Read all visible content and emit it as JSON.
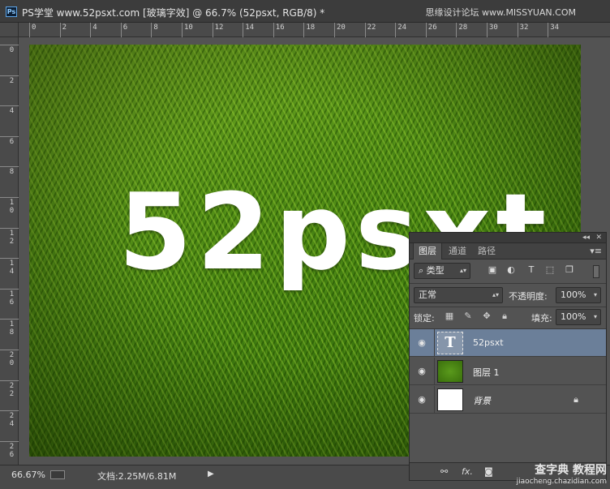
{
  "titlebar": {
    "app_badge": "Ps",
    "document_title": "PS学堂 www.52psxt.com [玻璃字效] @ 66.7% (52psxt, RGB/8) *",
    "watermark": "思缘设计论坛 www.MISSYUAN.COM"
  },
  "rulers": {
    "top": [
      "0",
      "2",
      "4",
      "6",
      "8",
      "10",
      "12",
      "14",
      "16",
      "18",
      "20",
      "22",
      "24",
      "26",
      "28",
      "30",
      "32",
      "34"
    ],
    "left": [
      "0",
      "2",
      "4",
      "6",
      "8",
      "10",
      "12",
      "14",
      "16",
      "18",
      "20",
      "22",
      "24",
      "26"
    ]
  },
  "canvas": {
    "text": "52psxt"
  },
  "statusbar": {
    "zoom": "66.67%",
    "doc_info": "文档:2.25M/6.81M",
    "menu_arrow": "▶"
  },
  "layers_panel": {
    "collapse": "◂◂",
    "close": "✕",
    "tabs": [
      {
        "label": "图层",
        "active": true
      },
      {
        "label": "通道",
        "active": false
      },
      {
        "label": "路径",
        "active": false
      }
    ],
    "menu": "▾≡",
    "filter_kind": "类型",
    "blend_mode": "正常",
    "opacity_label": "不透明度:",
    "opacity_value": "100%",
    "lock_label": "锁定:",
    "fill_label": "填充:",
    "fill_value": "100%",
    "layers": [
      {
        "name": "52psxt",
        "type": "text",
        "selected": true,
        "thumb_glyph": "T"
      },
      {
        "name": "图层 1",
        "type": "image",
        "selected": false
      },
      {
        "name": "背景",
        "type": "background",
        "selected": false,
        "locked": true
      }
    ],
    "bottom_icons": [
      "link-icon",
      "fx-icon",
      "mask-icon"
    ],
    "bottom_fx": "fx."
  },
  "watermark_bottom": {
    "line1": "查字典 教程网",
    "line2": "jiaocheng.chazidian.com"
  }
}
